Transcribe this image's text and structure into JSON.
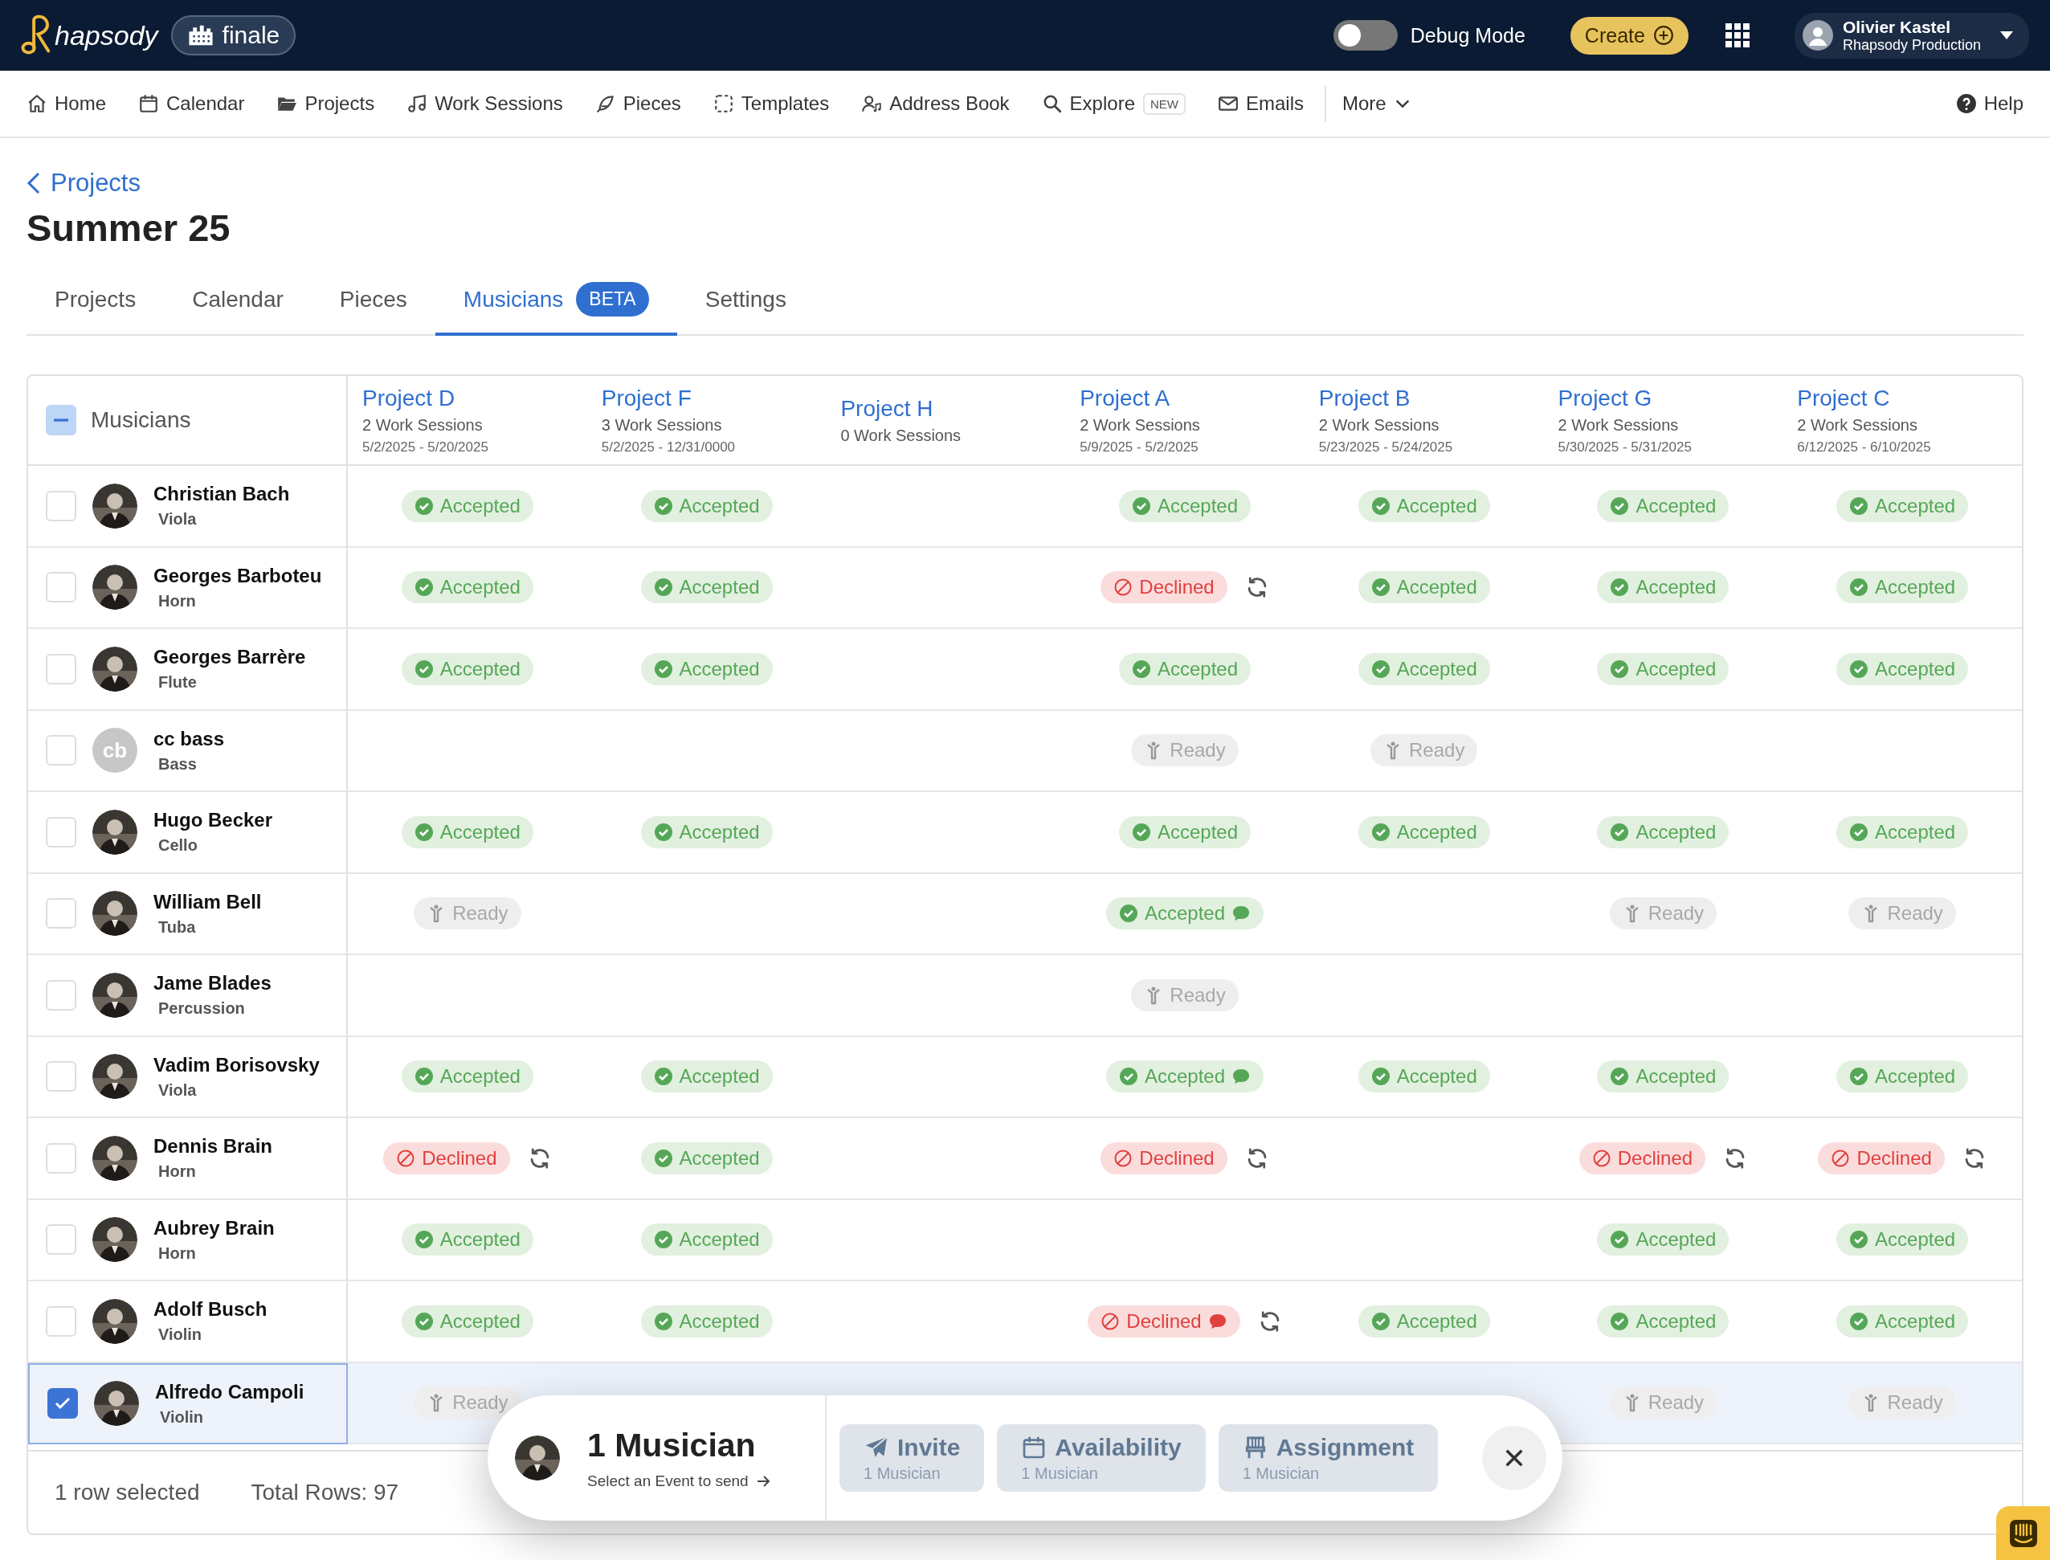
{
  "topbar": {
    "brand": "hapsody",
    "workspace": "finale",
    "debug": {
      "label": "Debug Mode",
      "on": false
    },
    "create": "Create",
    "user": {
      "name": "Olivier Kastel",
      "org": "Rhapsody Production"
    }
  },
  "nav": {
    "items": [
      {
        "label": "Home"
      },
      {
        "label": "Calendar"
      },
      {
        "label": "Projects"
      },
      {
        "label": "Work Sessions"
      },
      {
        "label": "Pieces"
      },
      {
        "label": "Templates"
      },
      {
        "label": "Address Book"
      },
      {
        "label": "Explore",
        "badge": "NEW"
      },
      {
        "label": "Emails"
      }
    ],
    "more": "More",
    "help": "Help"
  },
  "breadcrumb": "Projects",
  "title": "Summer 25",
  "tabs": [
    {
      "label": "Projects",
      "selected": false
    },
    {
      "label": "Calendar",
      "selected": false
    },
    {
      "label": "Pieces",
      "selected": false
    },
    {
      "label": "Musicians",
      "selected": true,
      "badge": "BETA"
    },
    {
      "label": "Settings",
      "selected": false
    }
  ],
  "table": {
    "indeterminate": true,
    "first_column": "Musicians",
    "columns": [
      {
        "name": "Project D",
        "sessions": "2 Work Sessions",
        "dates": "5/2/2025 - 5/20/2025"
      },
      {
        "name": "Project F",
        "sessions": "3 Work Sessions",
        "dates": "5/2/2025 - 12/31/0000"
      },
      {
        "name": "Project H",
        "sessions": "0 Work Sessions"
      },
      {
        "name": "Project A",
        "sessions": "2 Work Sessions",
        "dates": "5/9/2025 - 5/2/2025"
      },
      {
        "name": "Project B",
        "sessions": "2 Work Sessions",
        "dates": "5/23/2025 - 5/24/2025"
      },
      {
        "name": "Project G",
        "sessions": "2 Work Sessions",
        "dates": "5/30/2025 - 5/31/2025"
      },
      {
        "name": "Project C",
        "sessions": "2 Work Sessions",
        "dates": "6/12/2025 - 6/10/2025"
      }
    ],
    "rows": [
      {
        "name": "Christian Bach",
        "instrument": "Viola",
        "selected": false,
        "cells": [
          {
            "status": "Accepted",
            "kind": "accepted",
            "comment": false
          },
          {
            "status": "Accepted",
            "kind": "accepted",
            "comment": false
          },
          null,
          {
            "status": "Accepted",
            "kind": "accepted",
            "comment": false
          },
          {
            "status": "Accepted",
            "kind": "accepted",
            "comment": false
          },
          {
            "status": "Accepted",
            "kind": "accepted",
            "comment": false
          },
          {
            "status": "Accepted",
            "kind": "accepted",
            "comment": false
          }
        ]
      },
      {
        "name": "Georges Barboteu",
        "instrument": "Horn",
        "selected": false,
        "cells": [
          {
            "status": "Accepted",
            "kind": "accepted",
            "comment": false
          },
          {
            "status": "Accepted",
            "kind": "accepted",
            "comment": false
          },
          null,
          {
            "status": "Declined",
            "kind": "declined",
            "comment": false
          },
          {
            "status": "Accepted",
            "kind": "accepted",
            "comment": false
          },
          {
            "status": "Accepted",
            "kind": "accepted",
            "comment": false
          },
          {
            "status": "Accepted",
            "kind": "accepted",
            "comment": false
          }
        ]
      },
      {
        "name": "Georges Barrère",
        "instrument": "Flute",
        "selected": false,
        "cells": [
          {
            "status": "Accepted",
            "kind": "accepted",
            "comment": false
          },
          {
            "status": "Accepted",
            "kind": "accepted",
            "comment": false
          },
          null,
          {
            "status": "Accepted",
            "kind": "accepted",
            "comment": false
          },
          {
            "status": "Accepted",
            "kind": "accepted",
            "comment": false
          },
          {
            "status": "Accepted",
            "kind": "accepted",
            "comment": false
          },
          {
            "status": "Accepted",
            "kind": "accepted",
            "comment": false
          }
        ]
      },
      {
        "name": "cc bass",
        "instrument": "Bass",
        "avatar": {
          "kind": "initials",
          "text": "cb"
        },
        "selected": false,
        "cells": [
          null,
          null,
          null,
          {
            "status": "Ready",
            "kind": "ready",
            "comment": false
          },
          {
            "status": "Ready",
            "kind": "ready",
            "comment": false
          },
          null,
          null
        ]
      },
      {
        "name": "Hugo Becker",
        "instrument": "Cello",
        "selected": false,
        "cells": [
          {
            "status": "Accepted",
            "kind": "accepted",
            "comment": false
          },
          {
            "status": "Accepted",
            "kind": "accepted",
            "comment": false
          },
          null,
          {
            "status": "Accepted",
            "kind": "accepted",
            "comment": false
          },
          {
            "status": "Accepted",
            "kind": "accepted",
            "comment": false
          },
          {
            "status": "Accepted",
            "kind": "accepted",
            "comment": false
          },
          {
            "status": "Accepted",
            "kind": "accepted",
            "comment": false
          }
        ]
      },
      {
        "name": "William Bell",
        "instrument": "Tuba",
        "selected": false,
        "cells": [
          {
            "status": "Ready",
            "kind": "ready",
            "comment": false
          },
          null,
          null,
          {
            "status": "Accepted",
            "kind": "accepted",
            "comment": true
          },
          null,
          {
            "status": "Ready",
            "kind": "ready",
            "comment": false
          },
          {
            "status": "Ready",
            "kind": "ready",
            "comment": false
          }
        ]
      },
      {
        "name": "Jame Blades",
        "instrument": "Percussion",
        "selected": false,
        "cells": [
          null,
          null,
          null,
          {
            "status": "Ready",
            "kind": "ready",
            "comment": false
          },
          null,
          null,
          null
        ]
      },
      {
        "name": "Vadim Borisovsky",
        "instrument": "Viola",
        "selected": false,
        "cells": [
          {
            "status": "Accepted",
            "kind": "accepted",
            "comment": false
          },
          {
            "status": "Accepted",
            "kind": "accepted",
            "comment": false
          },
          null,
          {
            "status": "Accepted",
            "kind": "accepted",
            "comment": true
          },
          {
            "status": "Accepted",
            "kind": "accepted",
            "comment": false
          },
          {
            "status": "Accepted",
            "kind": "accepted",
            "comment": false
          },
          {
            "status": "Accepted",
            "kind": "accepted",
            "comment": false
          }
        ]
      },
      {
        "name": "Dennis Brain",
        "instrument": "Horn",
        "selected": false,
        "cells": [
          {
            "status": "Declined",
            "kind": "declined",
            "comment": false
          },
          {
            "status": "Accepted",
            "kind": "accepted",
            "comment": false
          },
          null,
          {
            "status": "Declined",
            "kind": "declined",
            "comment": false
          },
          null,
          {
            "status": "Declined",
            "kind": "declined",
            "comment": false
          },
          {
            "status": "Declined",
            "kind": "declined",
            "comment": false
          }
        ]
      },
      {
        "name": "Aubrey Brain",
        "instrument": "Horn",
        "selected": false,
        "cells": [
          {
            "status": "Accepted",
            "kind": "accepted",
            "comment": false
          },
          {
            "status": "Accepted",
            "kind": "accepted",
            "comment": false
          },
          null,
          null,
          null,
          {
            "status": "Accepted",
            "kind": "accepted",
            "comment": false
          },
          {
            "status": "Accepted",
            "kind": "accepted",
            "comment": false
          }
        ]
      },
      {
        "name": "Adolf Busch",
        "instrument": "Violin",
        "selected": false,
        "cells": [
          {
            "status": "Accepted",
            "kind": "accepted",
            "comment": false
          },
          {
            "status": "Accepted",
            "kind": "accepted",
            "comment": false
          },
          null,
          {
            "status": "Declined",
            "kind": "declined",
            "comment": true
          },
          {
            "status": "Accepted",
            "kind": "accepted",
            "comment": false
          },
          {
            "status": "Accepted",
            "kind": "accepted",
            "comment": false
          },
          {
            "status": "Accepted",
            "kind": "accepted",
            "comment": false
          }
        ]
      },
      {
        "name": "Alfredo Campoli",
        "instrument": "Violin",
        "selected": true,
        "cells": [
          {
            "status": "Ready",
            "kind": "ready",
            "comment": false
          },
          null,
          null,
          null,
          null,
          {
            "status": "Ready",
            "kind": "ready",
            "comment": false
          },
          {
            "status": "Ready",
            "kind": "ready",
            "comment": false
          }
        ]
      }
    ],
    "footer": {
      "selected": "1 row selected",
      "total": "Total Rows: 97"
    }
  },
  "selection_panel": {
    "title": "1 Musician",
    "hint": "Select an Event to send",
    "actions": [
      {
        "label": "Invite",
        "sub": "1 Musician"
      },
      {
        "label": "Availability",
        "sub": "1 Musician"
      },
      {
        "label": "Assignment",
        "sub": "1 Musician"
      }
    ]
  }
}
